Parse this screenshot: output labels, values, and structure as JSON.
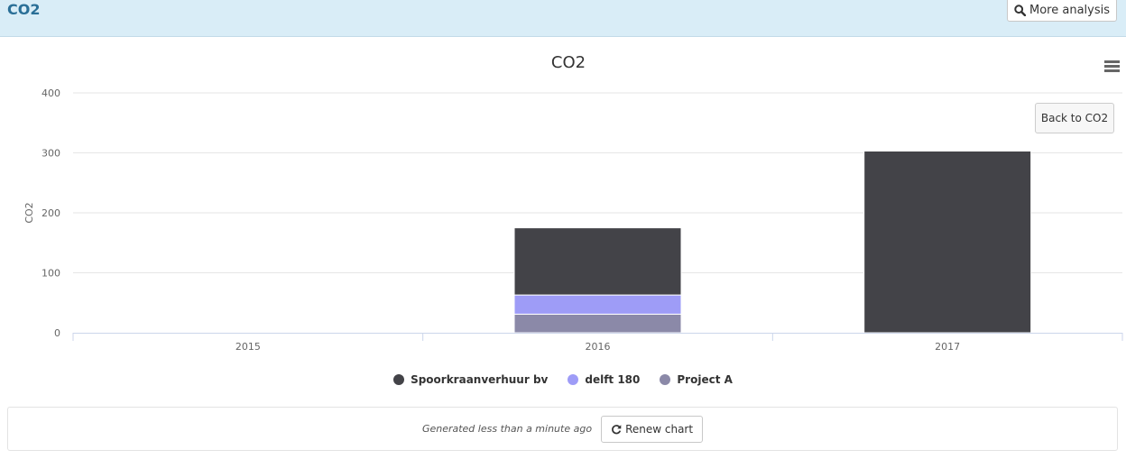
{
  "header": {
    "title": "CO2",
    "more_analysis_label": "More analysis",
    "more_analysis_icon": "search-icon"
  },
  "chart": {
    "menu_icon": "hamburger-menu-icon",
    "back_label": "Back to CO2"
  },
  "colors": {
    "header_bg": "#d9edf7",
    "title_color": "#2a6f97"
  },
  "chart_data": {
    "type": "bar",
    "stacked": true,
    "title": "CO2",
    "xlabel": "",
    "ylabel": "CO2",
    "categories": [
      "2015",
      "2016",
      "2017"
    ],
    "ylim": [
      0,
      400
    ],
    "yticks": [
      0,
      100,
      200,
      300,
      400
    ],
    "grid": true,
    "legend_position": "bottom-center",
    "series": [
      {
        "name": "Spoorkraanverhuur bv",
        "color": "#434348",
        "values": [
          0,
          112,
          303
        ]
      },
      {
        "name": "delft 180",
        "color": "#9e9cf7",
        "values": [
          0,
          32,
          0
        ]
      },
      {
        "name": "Project A",
        "color": "#8b89a8",
        "values": [
          0,
          31,
          0
        ]
      }
    ]
  },
  "footer": {
    "generated_text": "Generated less than a minute ago",
    "renew_label": "Renew chart",
    "renew_icon": "refresh-icon"
  }
}
